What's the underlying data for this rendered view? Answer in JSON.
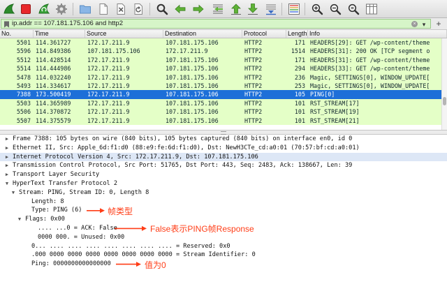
{
  "toolbar": {
    "buttons": [
      {
        "icon": "shark-fin-icon"
      },
      {
        "icon": "stop-square-icon"
      },
      {
        "icon": "restart-fin-icon"
      },
      {
        "icon": "gear-icon"
      },
      {
        "icon": "folder-icon"
      },
      {
        "icon": "file-icon"
      },
      {
        "icon": "close-file-icon"
      },
      {
        "icon": "reload-icon"
      },
      {
        "icon": "search-icon"
      },
      {
        "icon": "arrow-left-icon"
      },
      {
        "icon": "arrow-right-icon"
      },
      {
        "icon": "go-to-packet-icon"
      },
      {
        "icon": "arrow-up-icon"
      },
      {
        "icon": "arrow-down-icon"
      },
      {
        "icon": "autoscroll-icon"
      },
      {
        "icon": "colorize-icon"
      },
      {
        "icon": "zoom-in-icon"
      },
      {
        "icon": "zoom-out-icon"
      },
      {
        "icon": "zoom-reset-icon"
      },
      {
        "icon": "resize-columns-icon"
      }
    ]
  },
  "filter": {
    "value": "ip.addr == 107.181.175.106 and http2",
    "clear_glyph": "×",
    "dropdown_glyph": "▾",
    "add_glyph": "+"
  },
  "packet_list": {
    "columns": [
      "No.",
      "Time",
      "Source",
      "Destination",
      "Protocol",
      "Length",
      "Info"
    ],
    "rows": [
      {
        "no": "5501",
        "time": "114.361727",
        "src": "172.17.211.9",
        "dst": "107.181.175.106",
        "proto": "HTTP2",
        "len": "171",
        "info": "HEADERS[29]: GET /wp-content/theme"
      },
      {
        "no": "5596",
        "time": "114.849386",
        "src": "107.181.175.106",
        "dst": "172.17.211.9",
        "proto": "HTTP2",
        "len": "1514",
        "info": "HEADERS[31]: 200 OK [TCP segment o"
      },
      {
        "no": "5512",
        "time": "114.428514",
        "src": "172.17.211.9",
        "dst": "107.181.175.106",
        "proto": "HTTP2",
        "len": "171",
        "info": "HEADERS[31]: GET /wp-content/theme"
      },
      {
        "no": "5514",
        "time": "114.444986",
        "src": "172.17.211.9",
        "dst": "107.181.175.106",
        "proto": "HTTP2",
        "len": "294",
        "info": "HEADERS[33]: GET /wp-content/theme"
      },
      {
        "no": "5478",
        "time": "114.032240",
        "src": "172.17.211.9",
        "dst": "107.181.175.106",
        "proto": "HTTP2",
        "len": "236",
        "info": "Magic, SETTINGS[0], WINDOW_UPDATE["
      },
      {
        "no": "5493",
        "time": "114.334617",
        "src": "172.17.211.9",
        "dst": "107.181.175.106",
        "proto": "HTTP2",
        "len": "253",
        "info": "Magic, SETTINGS[0], WINDOW_UPDATE["
      },
      {
        "no": "7388",
        "time": "173.500419",
        "src": "172.17.211.9",
        "dst": "107.181.175.106",
        "proto": "HTTP2",
        "len": "105",
        "info": "PING[0]",
        "selected": true
      },
      {
        "no": "5503",
        "time": "114.365989",
        "src": "172.17.211.9",
        "dst": "107.181.175.106",
        "proto": "HTTP2",
        "len": "101",
        "info": "RST_STREAM[17]"
      },
      {
        "no": "5506",
        "time": "114.370872",
        "src": "172.17.211.9",
        "dst": "107.181.175.106",
        "proto": "HTTP2",
        "len": "101",
        "info": "RST_STREAM[19]"
      },
      {
        "no": "5507",
        "time": "114.375579",
        "src": "172.17.211.9",
        "dst": "107.181.175.106",
        "proto": "HTTP2",
        "len": "101",
        "info": "RST_STREAM[21]"
      }
    ]
  },
  "details": {
    "lines": [
      {
        "indent": 0,
        "tri": "▶",
        "text": "Frame 7388: 105 bytes on wire (840 bits), 105 bytes captured (840 bits) on interface en0, id 0"
      },
      {
        "indent": 0,
        "tri": "▶",
        "text": "Ethernet II, Src: Apple_6d:f1:d0 (88:e9:fe:6d:f1:d0), Dst: NewH3CTe_cd:a0:01 (70:57:bf:cd:a0:01)"
      },
      {
        "indent": 0,
        "tri": "▶",
        "text": "Internet Protocol Version 4, Src: 172.17.211.9, Dst: 107.181.175.106",
        "highlight": true
      },
      {
        "indent": 0,
        "tri": "▶",
        "text": "Transmission Control Protocol, Src Port: 51765, Dst Port: 443, Seq: 2483, Ack: 138667, Len: 39"
      },
      {
        "indent": 0,
        "tri": "▶",
        "text": "Transport Layer Security"
      },
      {
        "indent": 0,
        "tri": "▼",
        "text": "HyperText Transfer Protocol 2"
      },
      {
        "indent": 1,
        "tri": "▼",
        "text": "Stream: PING, Stream ID: 0, Length 8"
      },
      {
        "indent": 3,
        "tri": "",
        "text": "Length: 8"
      },
      {
        "indent": 3,
        "tri": "",
        "text": "Type: PING (6)"
      },
      {
        "indent": 2,
        "tri": "▼",
        "text": "Flags: 0x00"
      },
      {
        "indent": 4,
        "tri": "",
        "text": ".... ...0 = ACK: False"
      },
      {
        "indent": 4,
        "tri": "",
        "text": "0000 000. = Unused: 0x00"
      },
      {
        "indent": 3,
        "tri": "",
        "text": "0... .... .... .... .... .... .... .... = Reserved: 0x0"
      },
      {
        "indent": 3,
        "tri": "",
        "text": ".000 0000 0000 0000 0000 0000 0000 0000 = Stream Identifier: 0"
      },
      {
        "indent": 3,
        "tri": "",
        "text": "Ping: 0000000000000000"
      }
    ]
  },
  "annotations": [
    {
      "text": "帧类型",
      "line": 8
    },
    {
      "text": "False表示PING帧Response",
      "line": 10
    },
    {
      "text": "值为0",
      "line": 14
    }
  ],
  "colors": {
    "row_bg": "#e4ffc7",
    "selected_bg": "#1d6fd8",
    "filter_bg": "#d6f5c8",
    "annotation": "#ff3d17"
  }
}
